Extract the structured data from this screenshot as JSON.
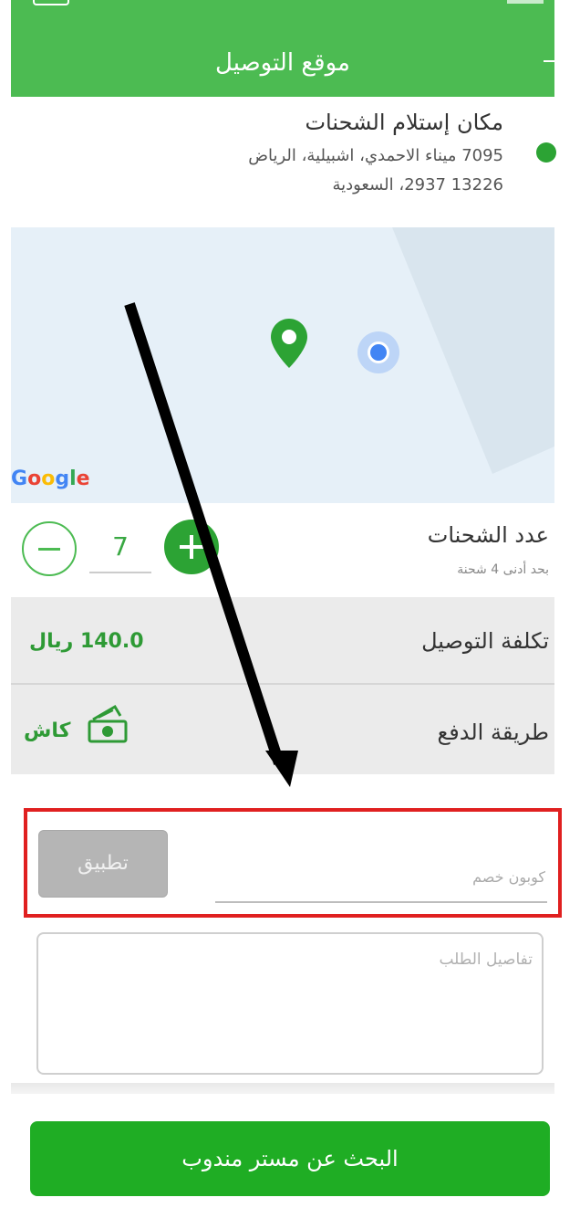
{
  "header": {
    "title": "موقع التوصيل"
  },
  "address": {
    "title": "مكان إستلام الشحنات",
    "line1": "7095 ميناء الاحمدي، اشبيلية، الرياض",
    "line2": "13226 2937، السعودية"
  },
  "map": {
    "attribution": "Google",
    "pin_icon": "map-pin-icon",
    "location_icon": "my-location-icon"
  },
  "shipments": {
    "label": "عدد الشحنات",
    "hint": "بحد أدنى 4 شحنة",
    "value": "7"
  },
  "delivery_cost": {
    "label": "تكلفة التوصيل",
    "value": "140.0 ريال"
  },
  "payment": {
    "label": "طريقة الدفع",
    "value": "كاش",
    "icon": "cash-icon"
  },
  "coupon": {
    "placeholder": "كوبون خصم",
    "apply_label": "تطبيق"
  },
  "order_details": {
    "placeholder": "تفاصيل الطلب"
  },
  "search_button": {
    "label": "البحث عن مستر مندوب"
  },
  "colors": {
    "primary_green": "#4cbb52",
    "dark_green": "#2ca334",
    "button_green": "#1fad24",
    "highlight_red": "#e02020",
    "row_grey": "#ebebeb"
  }
}
